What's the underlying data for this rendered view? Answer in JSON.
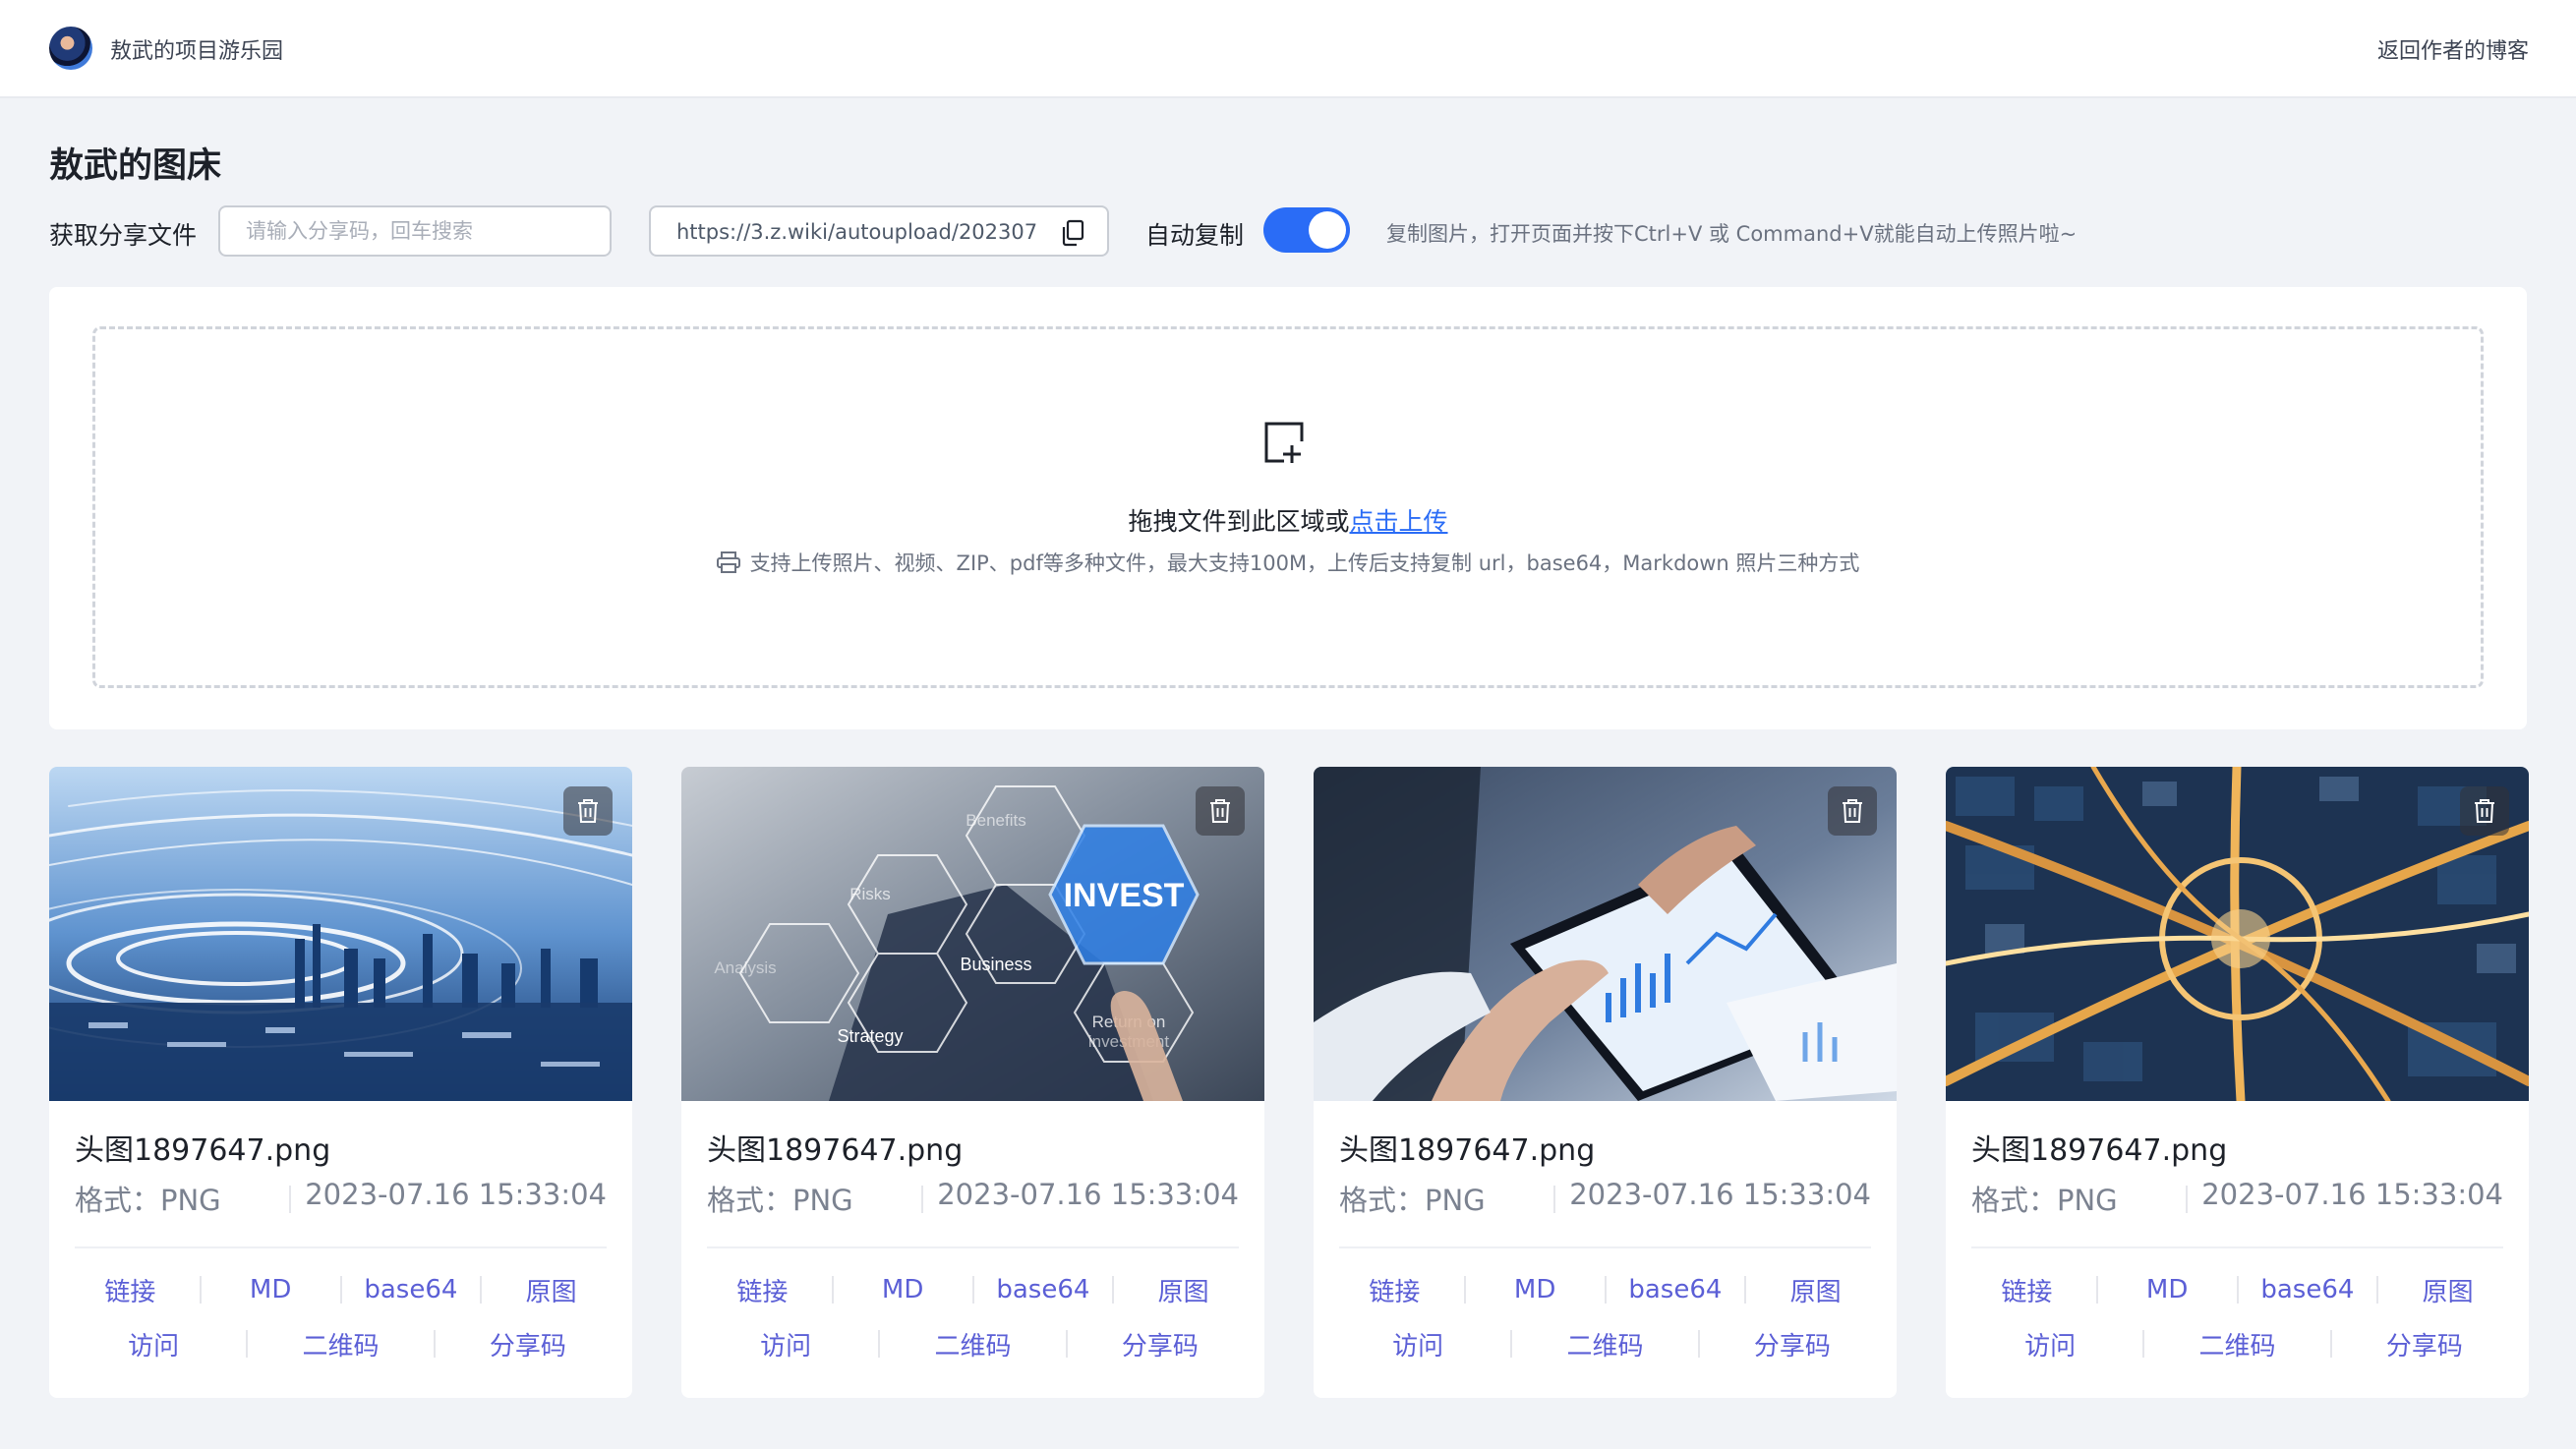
{
  "header": {
    "brand": "敖武的项目游乐园",
    "blog_link": "返回作者的博客"
  },
  "page": {
    "title": "敖武的图床"
  },
  "controls": {
    "share_label": "获取分享文件",
    "share_placeholder": "请输入分享码，回车搜索",
    "share_value": "",
    "url_value": "https://3.z.wiki/autoupload/202307",
    "auto_copy_label": "自动复制",
    "auto_copy_on": true,
    "hint": "复制图片，打开页面并按下Ctrl+V 或 Command+V就能自动上传照片啦~"
  },
  "upload": {
    "drop_text": "拖拽文件到此区域或",
    "click_upload": "点击上传",
    "support_text": "支持上传照片、视频、ZIP、pdf等多种文件，最大支持100M，上传后支持复制 url，base64，Markdown 照片三种方式"
  },
  "colors": {
    "accent": "#2a6cf6",
    "action_link": "#5b5fd6",
    "page_bg": "#f1f3f7"
  },
  "cards": [
    {
      "image": "light-speed-city",
      "name": "头图1897647.png",
      "format": "格式：PNG",
      "date": "2023-07.16 15:33:04",
      "actions_row1": [
        "链接",
        "MD",
        "base64",
        "原图"
      ],
      "actions_row2": [
        "访问",
        "二维码",
        "分享码"
      ]
    },
    {
      "image": "invest-hexagons",
      "name": "头图1897647.png",
      "format": "格式：PNG",
      "date": "2023-07.16 15:33:04",
      "hex_labels": [
        "Benefits",
        "Risks",
        "INVEST",
        "Analysis",
        "Business",
        "Strategy",
        "Return on",
        "investment"
      ],
      "actions_row1": [
        "链接",
        "MD",
        "base64",
        "原图"
      ],
      "actions_row2": [
        "访问",
        "二维码",
        "分享码"
      ]
    },
    {
      "image": "tablet-charts",
      "name": "头图1897647.png",
      "format": "格式：PNG",
      "date": "2023-07.16 15:33:04",
      "actions_row1": [
        "链接",
        "MD",
        "base64",
        "原图"
      ],
      "actions_row2": [
        "访问",
        "二维码",
        "分享码"
      ]
    },
    {
      "image": "highway-interchange",
      "name": "头图1897647.png",
      "format": "格式：PNG",
      "date": "2023-07.16 15:33:04",
      "actions_row1": [
        "链接",
        "MD",
        "base64",
        "原图"
      ],
      "actions_row2": [
        "访问",
        "二维码",
        "分享码"
      ]
    }
  ]
}
